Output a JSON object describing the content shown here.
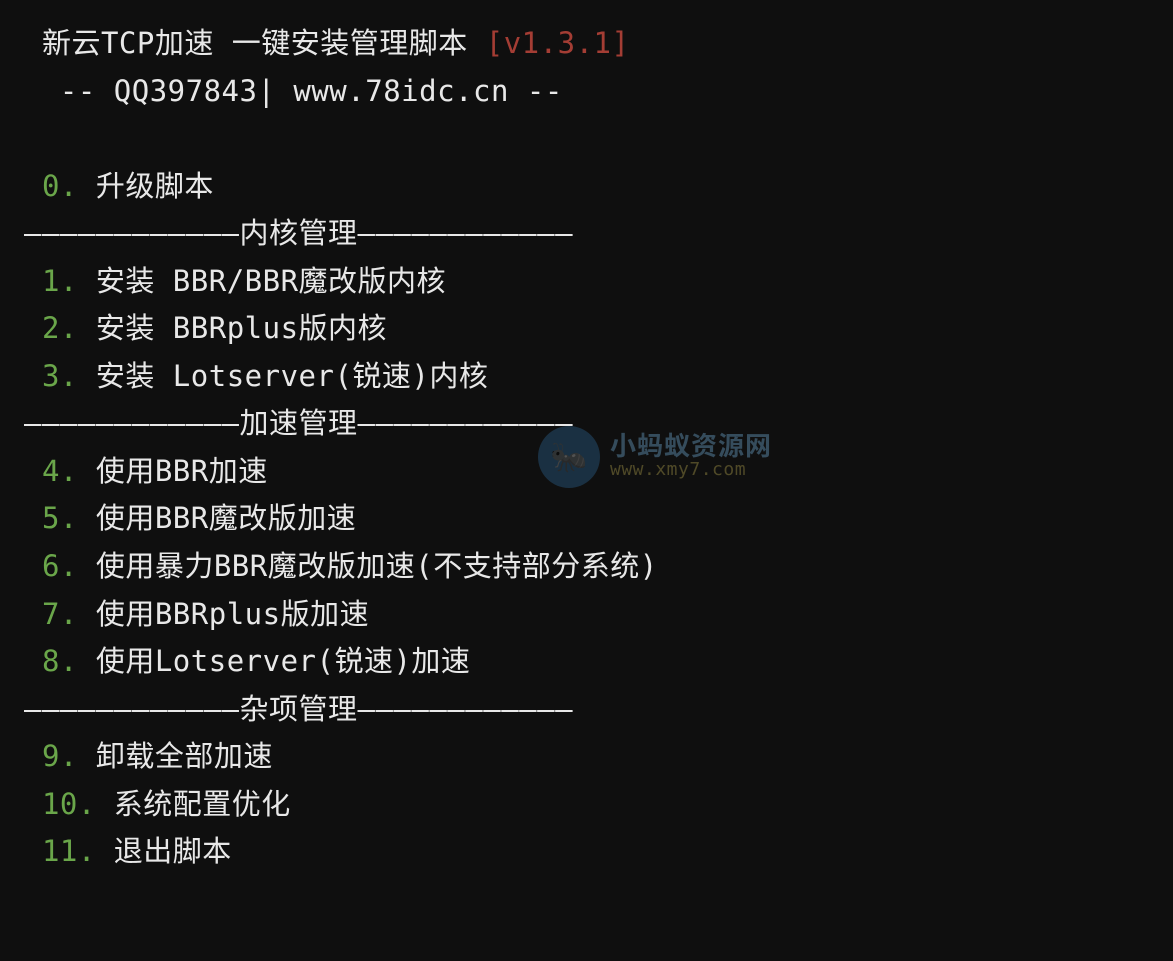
{
  "header": {
    "title_left": " 新云TCP加速 一键安装管理脚本 ",
    "version": "[v1.3.1]",
    "subline": "  -- QQ397843| www.78idc.cn --"
  },
  "menu": {
    "item0_num": " 0.",
    "item0_text": " 升级脚本",
    "sep_kernel": "————————————内核管理————————————",
    "item1_num": " 1.",
    "item1_text": " 安装 BBR/BBR魔改版内核",
    "item2_num": " 2.",
    "item2_text": " 安装 BBRplus版内核",
    "item3_num": " 3.",
    "item3_text": " 安装 Lotserver(锐速)内核",
    "sep_accel": "————————————加速管理————————————",
    "item4_num": " 4.",
    "item4_text": " 使用BBR加速",
    "item5_num": " 5.",
    "item5_text": " 使用BBR魔改版加速",
    "item6_num": " 6.",
    "item6_text": " 使用暴力BBR魔改版加速(不支持部分系统)",
    "item7_num": " 7.",
    "item7_text": " 使用BBRplus版加速",
    "item8_num": " 8.",
    "item8_text": " 使用Lotserver(锐速)加速",
    "sep_misc": "————————————杂项管理————————————",
    "item9_num": " 9.",
    "item9_text": " 卸载全部加速",
    "item10_num": " 10.",
    "item10_text": " 系统配置优化",
    "item11_num": " 11.",
    "item11_text": " 退出脚本"
  },
  "watermark": {
    "line1": "小蚂蚁资源网",
    "line2": "www.xmy7.com",
    "icon": "🐜"
  },
  "colors": {
    "bg": "#0f0f0f",
    "text": "#e8e8e8",
    "green": "#6aa64a",
    "darkred": "#a43d34"
  }
}
